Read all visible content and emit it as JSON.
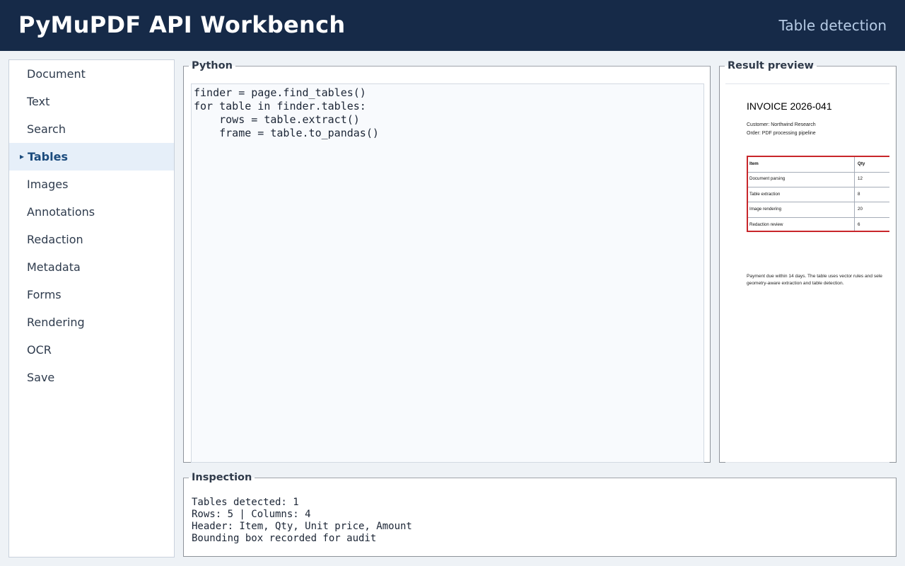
{
  "header": {
    "title": "PyMuPDF API Workbench",
    "subtitle": "Table detection"
  },
  "sidebar": {
    "active_marker": "▸",
    "items": [
      {
        "label": "Document",
        "active": false
      },
      {
        "label": "Text",
        "active": false
      },
      {
        "label": "Search",
        "active": false
      },
      {
        "label": "Tables",
        "active": true
      },
      {
        "label": "Images",
        "active": false
      },
      {
        "label": "Annotations",
        "active": false
      },
      {
        "label": "Redaction",
        "active": false
      },
      {
        "label": "Metadata",
        "active": false
      },
      {
        "label": "Forms",
        "active": false
      },
      {
        "label": "Rendering",
        "active": false
      },
      {
        "label": "OCR",
        "active": false
      },
      {
        "label": "Save",
        "active": false
      }
    ]
  },
  "python": {
    "legend": "Python",
    "code": "finder = page.find_tables()\nfor table in finder.tables:\n    rows = table.extract()\n    frame = table.to_pandas()"
  },
  "preview": {
    "legend": "Result preview",
    "doc_title": "INVOICE 2026-041",
    "customer": "Customer: Northwind Research",
    "order": "Order: PDF processing pipeline",
    "table": {
      "header": [
        "Item",
        "Qty"
      ],
      "rows": [
        [
          "Document parsing",
          "12"
        ],
        [
          "Table extraction",
          "8"
        ],
        [
          "Image rendering",
          "20"
        ],
        [
          "Redaction review",
          "6"
        ]
      ],
      "highlight_color": "#c8262a"
    },
    "footer_line1": "Payment due within 14 days. The table uses vector rules and sele",
    "footer_line2": "geometry-aware extraction and table detection."
  },
  "inspection": {
    "legend": "Inspection",
    "lines": [
      "Tables detected: 1",
      "Rows: 5 | Columns: 4",
      "Header: Item, Qty, Unit price, Amount",
      "Bounding box recorded for audit"
    ]
  },
  "colors": {
    "header_bg": "#162a48",
    "active_item_bg": "#e6eff9",
    "active_item_text": "#1b4b7d"
  }
}
